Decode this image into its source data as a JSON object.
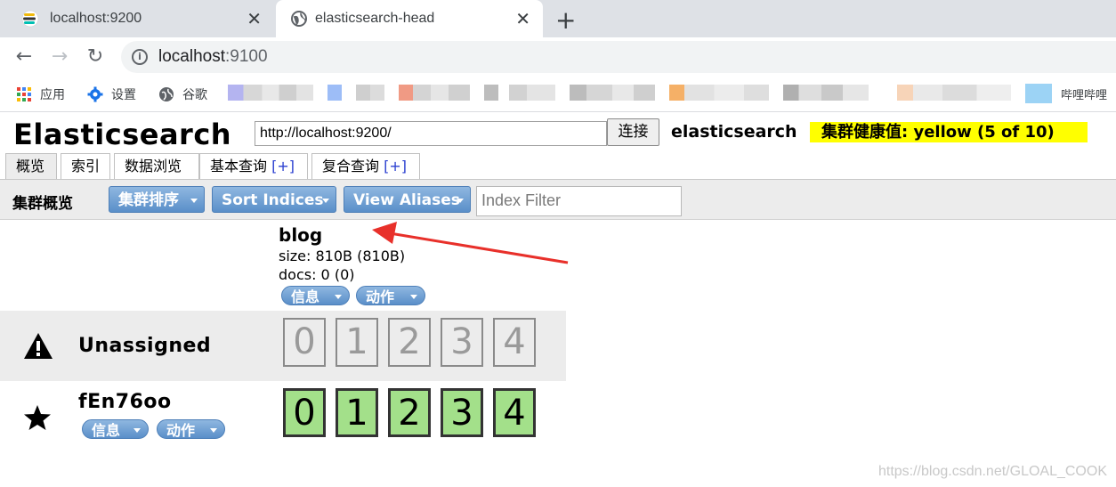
{
  "browser": {
    "tabs": [
      {
        "title": "localhost:9200",
        "icon": "elastic-logo-icon",
        "active": false
      },
      {
        "title": "elasticsearch-head",
        "icon": "globe-icon",
        "active": true
      }
    ],
    "address": {
      "host": "localhost",
      "port": ":9100"
    },
    "bookmarks": [
      {
        "label": "应用",
        "icon": "apps-grid-icon"
      },
      {
        "label": "设置",
        "icon": "gear-icon"
      },
      {
        "label": "谷歌",
        "icon": "globe-icon"
      }
    ],
    "bookmark_tail": "哔哩哔哩"
  },
  "app": {
    "brand": "Elasticsearch",
    "connect_url": "http://localhost:9200/",
    "connect_label": "连接",
    "cluster_name": "elasticsearch",
    "health_text": "集群健康值: yellow (5 of 10)",
    "health_color": "#ffff00",
    "tabs": [
      {
        "label": "概览",
        "plus": ""
      },
      {
        "label": "索引",
        "plus": ""
      },
      {
        "label": "数据浏览",
        "plus": ""
      },
      {
        "label": "基本查询 ",
        "plus": "[+]"
      },
      {
        "label": "复合查询 ",
        "plus": "[+]"
      }
    ],
    "overview": {
      "title": "集群概览",
      "sort_cluster": "集群排序",
      "sort_indices": "Sort Indices",
      "view_aliases": "View Aliases",
      "filter_placeholder": "Index Filter"
    },
    "index": {
      "name": "blog",
      "size": "size: 810B (810B)",
      "docs": "docs: 0 (0)",
      "info_label": "信息",
      "action_label": "动作"
    },
    "nodes": [
      {
        "name": "Unassigned",
        "icon": "warning-icon",
        "shards": [
          "0",
          "1",
          "2",
          "3",
          "4"
        ],
        "state": "unassigned"
      },
      {
        "name": "fEn76oo",
        "icon": "star-icon",
        "shards": [
          "0",
          "1",
          "2",
          "3",
          "4"
        ],
        "state": "started",
        "info_label": "信息",
        "action_label": "动作"
      }
    ],
    "shard_colors": {
      "started": "#a3e08a",
      "unassigned": "#ececec"
    }
  },
  "watermark": "https://blog.csdn.net/GLOAL_COOK"
}
